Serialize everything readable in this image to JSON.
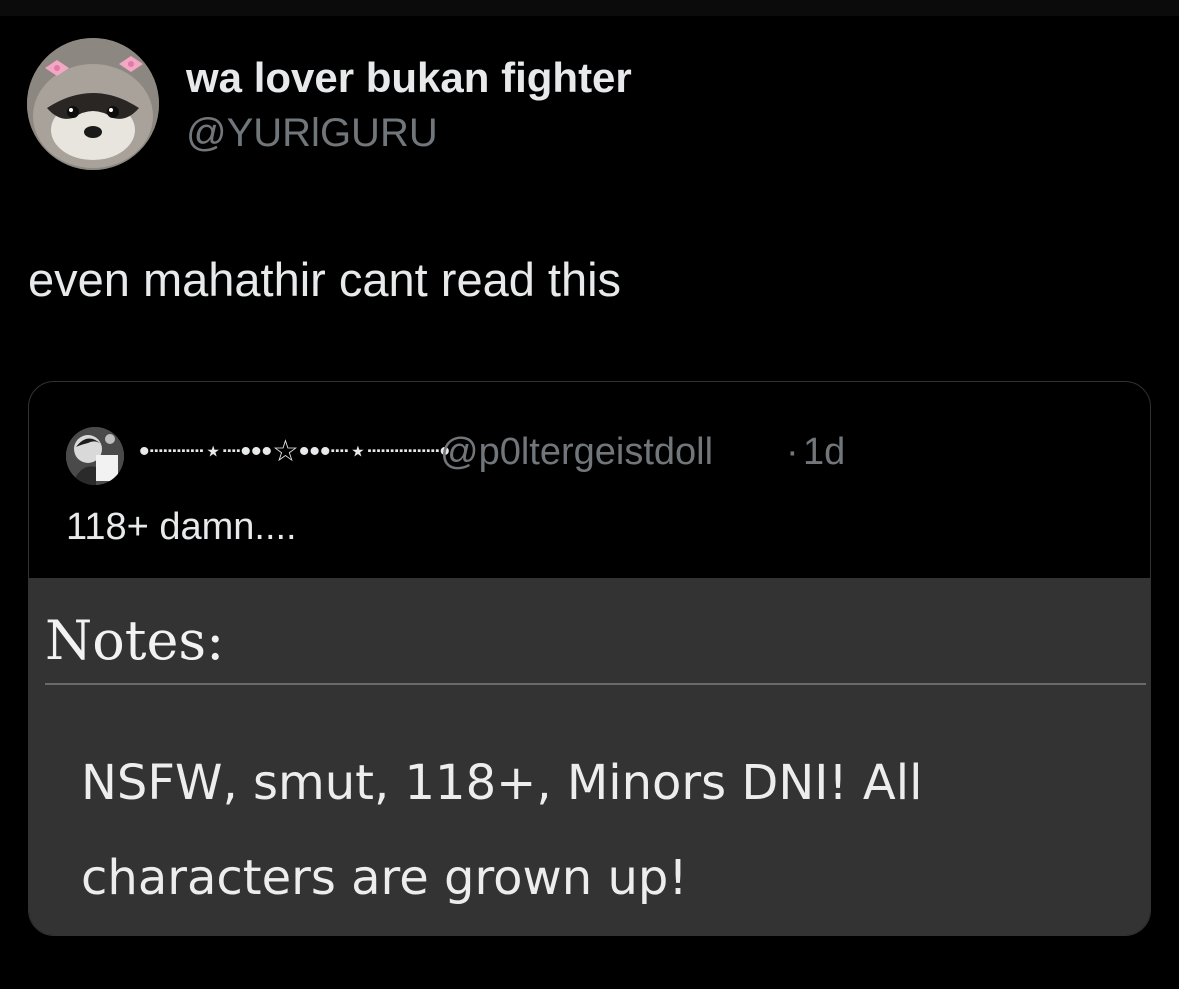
{
  "tweet": {
    "author": {
      "display_name": "wa lover bukan fighter",
      "handle": "@YURlGURU",
      "avatar_icon": "raccoon-avatar-icon"
    },
    "text": "even mahathir cant read this",
    "quote": {
      "author": {
        "display_name": "•┈┈┈⋆┈•••☆•••┈⋆┈┈┈┈•",
        "handle": "@p0ltergeistdoll",
        "separator": "·",
        "time": "1d",
        "avatar_icon": "anime-avatar-icon"
      },
      "text": "118+ damn....",
      "image": {
        "heading": "Notes:",
        "body": "NSFW, smut, 118+, Minors DNI! All characters are grown up!"
      }
    }
  },
  "colors": {
    "background": "#000000",
    "primary_text": "#e7e9ea",
    "secondary_text": "#71767b",
    "border": "#2f3336",
    "image_background": "#333333"
  }
}
